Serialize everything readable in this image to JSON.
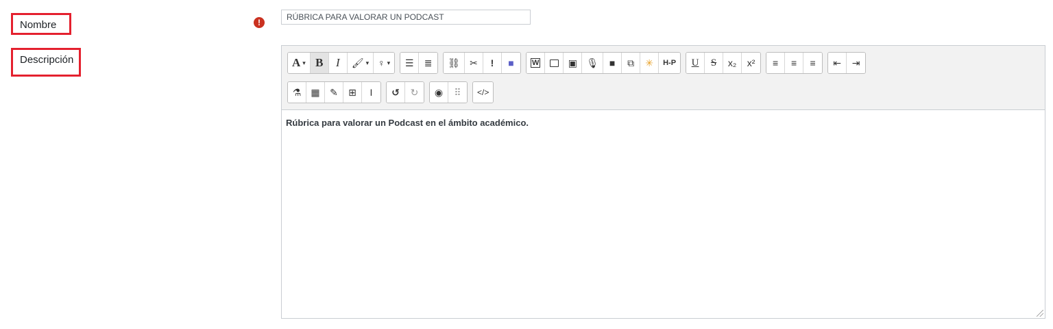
{
  "form": {
    "name_label": "Nombre",
    "description_label": "Descripción",
    "required_icon": "!",
    "name_value": "RÚBRICA PARA VALORAR UN PODCAST",
    "description_content": "Rúbrica para valorar un Podcast en el ámbito académico."
  },
  "toolbar": {
    "font": "A",
    "bold": "B",
    "italic": "I",
    "caret": "▾",
    "h5p": "H-P",
    "underline": "U",
    "strike": "S",
    "sub": "x₂",
    "sup": "x²",
    "html": "</>",
    "accent_color": "#e4202e"
  }
}
